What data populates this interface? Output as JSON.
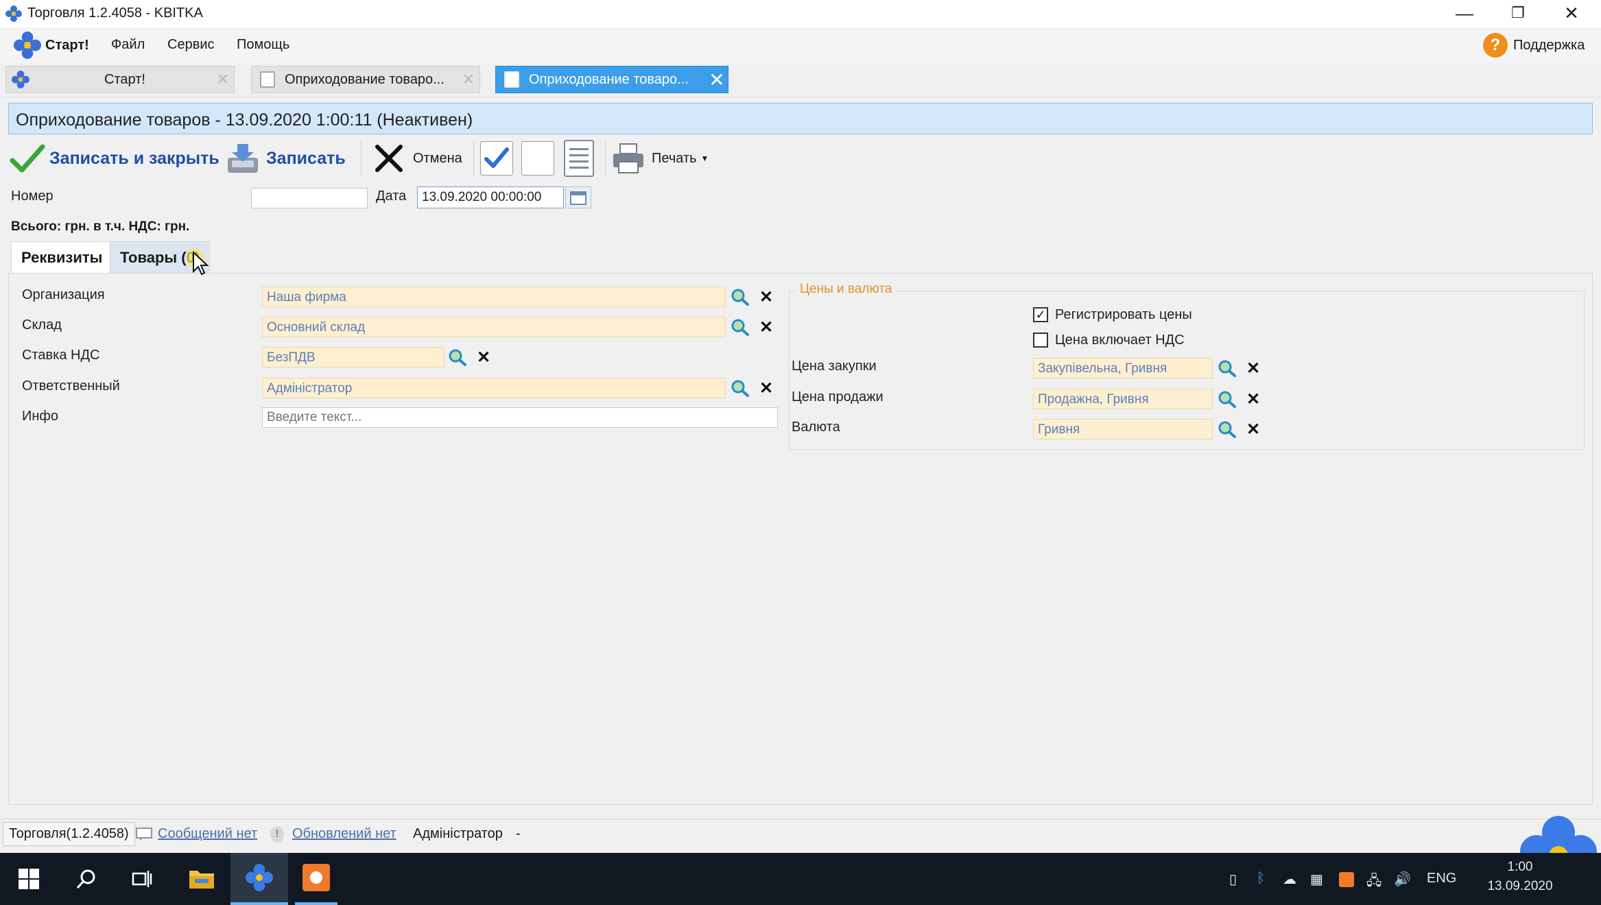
{
  "window": {
    "title": "Торговля 1.2.4058 - KBITKA",
    "minimize": "—",
    "restore": "❐",
    "close": "✕"
  },
  "menu": {
    "start": "Старт!",
    "items": [
      "Файл",
      "Сервис",
      "Помощь"
    ],
    "support": "Поддержка"
  },
  "tabs": [
    {
      "label": "Старт!",
      "active": false
    },
    {
      "label": "Оприходование товаро...",
      "active": false
    },
    {
      "label": "Оприходование  товаро...",
      "active": true
    }
  ],
  "document": {
    "header": "Оприходование товаров  - 13.09.2020 1:00:11 (Неактивен)"
  },
  "toolbar": {
    "save_close": "Записать и закрыть",
    "save": "Записать",
    "cancel": "Отмена",
    "print": "Печать"
  },
  "header_fields": {
    "number_label": "Номер",
    "number_value": "",
    "date_label": "Дата",
    "date_value": "13.09.2020 00:00:00",
    "totals": "Всього:  грн. в т.ч. НДС:  грн."
  },
  "inner_tabs": {
    "rekvizity": "Реквизиты",
    "tovary": "Товары (0)"
  },
  "fields": {
    "organization": {
      "label": "Организация",
      "value": "Наша фирма"
    },
    "warehouse": {
      "label": "Склад",
      "value": "Основний склад"
    },
    "vat_rate": {
      "label": "Ставка НДС",
      "value": "БезПДВ"
    },
    "responsible": {
      "label": "Ответственный",
      "value": "Адміністратор"
    },
    "info": {
      "label": "Инфо",
      "placeholder": "Введите текст..."
    }
  },
  "prices_group": {
    "title": "Цены и валюта",
    "register_prices": {
      "label": "Регистрировать цены",
      "checked": true
    },
    "price_includes_vat": {
      "label": "Цена включает НДС",
      "checked": false
    },
    "purchase_price": {
      "label": "Цена закупки",
      "value": "Закупівельна, Гривня"
    },
    "sale_price": {
      "label": "Цена продажи",
      "value": "Продажна, Гривня"
    },
    "currency": {
      "label": "Валюта",
      "value": "Гривня"
    }
  },
  "statusbar": {
    "app": "Торговля(1.2.4058)",
    "messages": "Сообщений нет",
    "updates": "Обновлений нет",
    "user": "Адміністратор",
    "suffix": "-"
  },
  "taskbar": {
    "lang": "ENG",
    "time": "1:00",
    "date": "13.09.2020"
  },
  "colors": {
    "accent_tab": "#3c9ee8",
    "header_bg": "#d3e7fb",
    "ref_field_bg": "#fdefcf",
    "group_title": "#e0922b"
  }
}
